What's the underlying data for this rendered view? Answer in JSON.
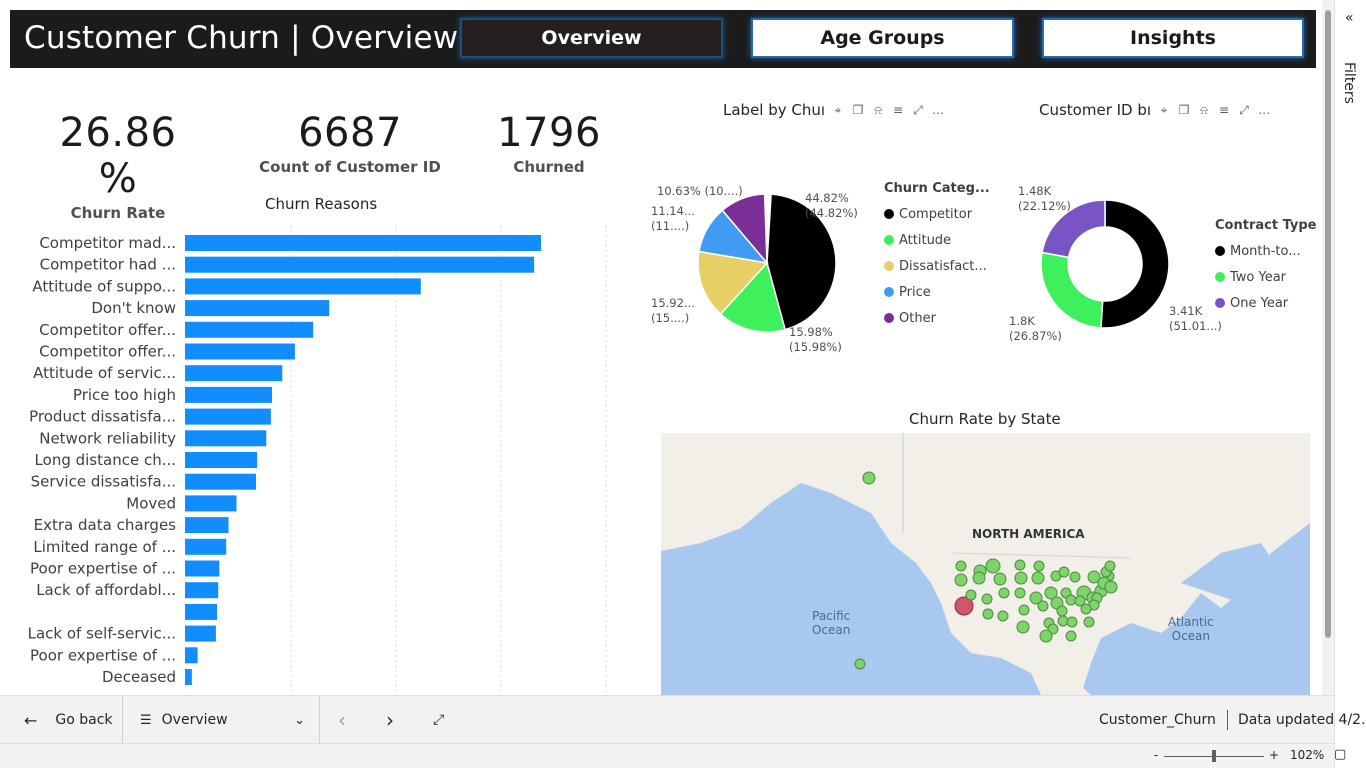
{
  "header": {
    "title": "Customer Churn |  Overview",
    "nav": [
      {
        "label": "Overview",
        "active": true
      },
      {
        "label": "Age Groups",
        "active": false
      },
      {
        "label": "Insights",
        "active": false
      }
    ]
  },
  "kpis": [
    {
      "value": "26.86 %",
      "label": "Churn Rate"
    },
    {
      "value": "6687",
      "label": "Count of Customer ID"
    },
    {
      "value": "1796",
      "label": "Churned"
    }
  ],
  "churn_reasons": {
    "title": "Churn Reasons",
    "labels": [
      "Competitor mad...",
      "Competitor had ...",
      "Attitude of suppo...",
      "Don't know",
      "Competitor offer...",
      "Competitor offer...",
      "Attitude of servic...",
      "Price too high",
      "Product dissatisfa...",
      "Network reliability",
      "Long distance ch...",
      "Service dissatisfa...",
      "Moved",
      "Extra data charges",
      "Limited range of ...",
      "Poor expertise of ...",
      "Lack of affordabl...",
      "",
      "Lack of self-servic...",
      "Poor expertise of ...",
      "Deceased"
    ],
    "values": [
      311,
      305,
      206,
      126,
      112,
      96,
      85,
      76,
      75,
      71,
      63,
      62,
      45,
      38,
      36,
      30,
      29,
      28,
      27,
      11,
      6
    ]
  },
  "pie_chart": {
    "title": "Label by Chuı",
    "legend_title": "Churn Categ...",
    "slices": [
      {
        "name": "Competitor",
        "value": 44.82,
        "color": "#000000",
        "label": "44.82%",
        "sublabel": "(44.82%)"
      },
      {
        "name": "Attitude",
        "value": 15.98,
        "color": "#3ef05c",
        "label": "15.98%",
        "sublabel": "(15.98%)"
      },
      {
        "name": "Dissatisfact...",
        "value": 15.92,
        "color": "#e6cf65",
        "label": "15.92...",
        "sublabel": "(15....)"
      },
      {
        "name": "Price",
        "value": 11.14,
        "color": "#3f9cf2",
        "label": "11.14...",
        "sublabel": "(11....)"
      },
      {
        "name": "Other",
        "value": 10.63,
        "color": "#7a2f96",
        "label": "10.63% (10....)",
        "sublabel": ""
      }
    ]
  },
  "donut_chart": {
    "title": "Customer ID bı",
    "legend_title": "Contract Type",
    "slices": [
      {
        "name": "Month-to...",
        "value": 51.01,
        "color": "#000000",
        "label": "3.41K",
        "sublabel": "(51.01...)"
      },
      {
        "name": "Two Year",
        "value": 26.87,
        "color": "#3ef05c",
        "label": "1.8K",
        "sublabel": "(26.87%)"
      },
      {
        "name": "One Year",
        "value": 22.12,
        "color": "#7a53c4",
        "label": "1.48K",
        "sublabel": "(22.12%)"
      }
    ]
  },
  "map": {
    "title": "Churn Rate by State",
    "labels": {
      "continent": "NORTH AMERICA",
      "pacific_1": "Pacific",
      "pacific_2": "Ocean",
      "atlantic_1": "Atlantic",
      "atlantic_2": "Ocean"
    },
    "bubble_color": "#7ed36b",
    "highlight_color": "#d0566a"
  },
  "filters_label": "Filters",
  "footer": {
    "go_back": "Go back",
    "page_select": "Overview",
    "report_name": "Customer_Churn",
    "data_updated": "Data updated 4/2...",
    "zoom": "102%",
    "zoom_minus": "-",
    "zoom_plus": "+"
  },
  "icons": {
    "back": "←",
    "page_list": "☰",
    "dropdown": "⌄",
    "prev": "‹",
    "next": "›",
    "collapse": "⤢",
    "fit_page": "▢",
    "panel_collapse": "«",
    "ellipsis": "…"
  }
}
